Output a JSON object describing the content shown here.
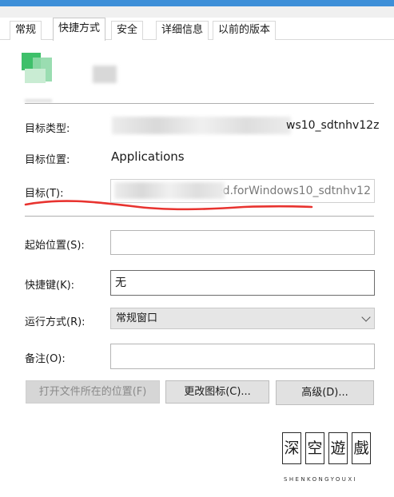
{
  "tabs": [
    {
      "label": "常规"
    },
    {
      "label": "快捷方式",
      "active": true
    },
    {
      "label": "安全"
    },
    {
      "label": "详细信息"
    },
    {
      "label": "以前的版本"
    }
  ],
  "target_type": {
    "label": "目标类型:",
    "value": "ws10_sdtnhv12z"
  },
  "target_location": {
    "label": "目标位置:",
    "value": "Applications"
  },
  "target": {
    "label": "目标(T):",
    "value": "ted.forWindows10_sdtnhv12"
  },
  "start_in": {
    "label": "起始位置(S):",
    "value": ""
  },
  "shortcut_key": {
    "label": "快捷键(K):",
    "value": "无"
  },
  "run": {
    "label": "运行方式(R):",
    "value": "常规窗口"
  },
  "comment": {
    "label": "备注(O):",
    "value": ""
  },
  "buttons": {
    "open_location": "打开文件所在的位置(F)",
    "change_icon": "更改图标(C)...",
    "advanced": "高级(D)..."
  },
  "watermark": {
    "chars": [
      "深",
      "空",
      "遊",
      "戲"
    ],
    "sub": "SHENKONGYOUXI"
  },
  "colors": {
    "annotation_underline": "#e8332f",
    "title_accent": "#3d8fd8"
  }
}
